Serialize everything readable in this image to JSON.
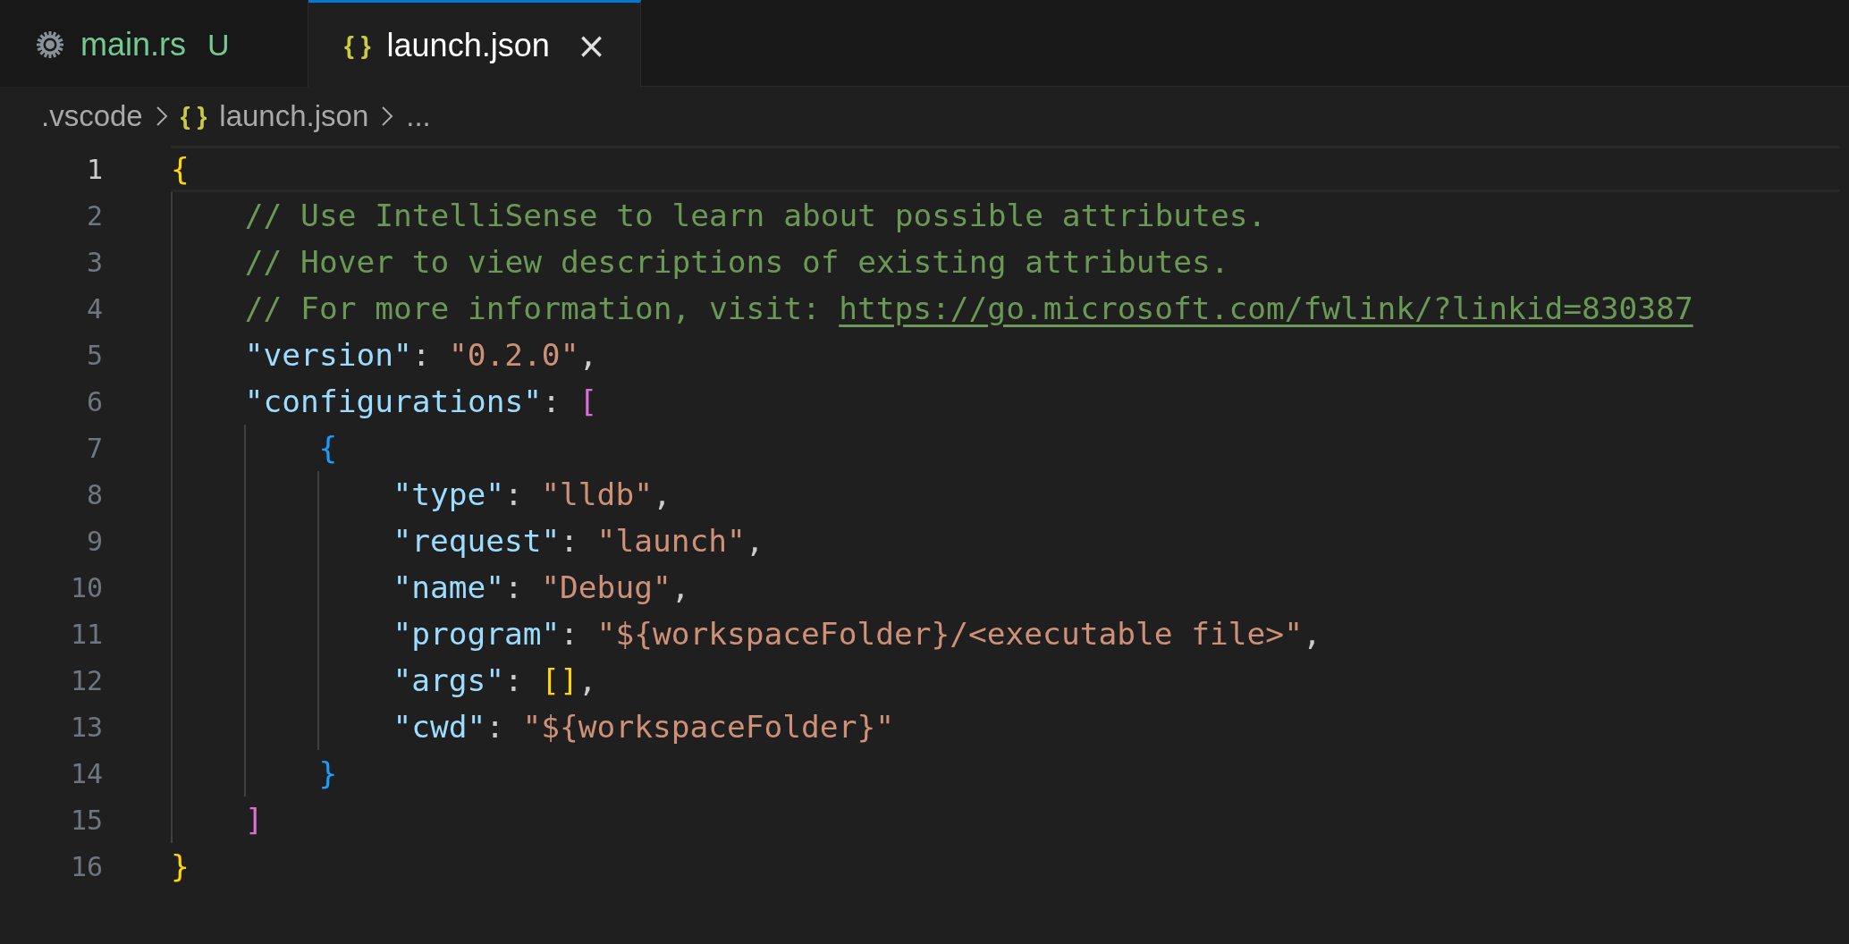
{
  "tabs": [
    {
      "label": "main.rs",
      "icon": {
        "kind": "cog"
      },
      "badge": "U",
      "selected": false
    },
    {
      "label": "launch.json",
      "icon": {
        "kind": "glyph",
        "text": "{ }"
      },
      "close": "×",
      "selected": true
    }
  ],
  "breadcrumbs": [
    {
      "label": ".vscode"
    },
    {
      "label": "launch.json",
      "icon": "{ }"
    },
    {
      "label": "..."
    }
  ],
  "editor": {
    "lines": [
      {
        "number": "1",
        "current": true,
        "tokens": [
          {
            "kind": "bracket",
            "text": "{",
            "color": "#ffd700"
          }
        ],
        "children": [
          {
            "number": "2",
            "current": false,
            "tokens": [
              {
                "kind": "comment",
                "text": "// Use IntelliSense to learn about possible attributes."
              }
            ]
          },
          {
            "number": "3",
            "current": false,
            "tokens": [
              {
                "kind": "comment",
                "text": "// Hover to view descriptions of existing attributes."
              }
            ]
          },
          {
            "number": "4",
            "current": false,
            "tokens": [
              {
                "kind": "comment",
                "text": "// For more information, visit:"
              },
              {
                "kind": "link",
                "text": "https://go.microsoft.com/fwlink/?linkid=830387"
              }
            ]
          },
          {
            "number": "5",
            "current": false,
            "tokens": [
              {
                "kind": "key",
                "text": "\"version\""
              },
              {
                "kind": "punct",
                "text": ":"
              },
              {
                "kind": "string",
                "text": "\"0.2.0\""
              },
              {
                "kind": "punct",
                "text": ","
              }
            ]
          },
          {
            "number": "6",
            "current": false,
            "tokens": [
              {
                "kind": "key",
                "text": "\"configurations\""
              },
              {
                "kind": "punct",
                "text": ":"
              },
              {
                "kind": "bracket",
                "text": "[",
                "color": "#da70d6"
              }
            ],
            "children": [
              {
                "number": "7",
                "current": false,
                "tokens": [
                  {
                    "kind": "bracket",
                    "text": "{",
                    "color": "#179fff"
                  }
                ],
                "children": [
                  {
                    "number": "8",
                    "current": false,
                    "tokens": [
                      {
                        "kind": "key",
                        "text": "\"type\""
                      },
                      {
                        "kind": "punct",
                        "text": ":"
                      },
                      {
                        "kind": "string",
                        "text": "\"lldb\""
                      },
                      {
                        "kind": "punct",
                        "text": ","
                      }
                    ]
                  },
                  {
                    "number": "9",
                    "current": false,
                    "tokens": [
                      {
                        "kind": "key",
                        "text": "\"request\""
                      },
                      {
                        "kind": "punct",
                        "text": ":"
                      },
                      {
                        "kind": "string",
                        "text": "\"launch\""
                      },
                      {
                        "kind": "punct",
                        "text": ","
                      }
                    ]
                  },
                  {
                    "number": "10",
                    "current": false,
                    "tokens": [
                      {
                        "kind": "key",
                        "text": "\"name\""
                      },
                      {
                        "kind": "punct",
                        "text": ":"
                      },
                      {
                        "kind": "string",
                        "text": "\"Debug\""
                      },
                      {
                        "kind": "punct",
                        "text": ","
                      }
                    ]
                  },
                  {
                    "number": "11",
                    "current": false,
                    "tokens": [
                      {
                        "kind": "key",
                        "text": "\"program\""
                      },
                      {
                        "kind": "punct",
                        "text": ":"
                      },
                      {
                        "kind": "string",
                        "text": "\"${workspaceFolder}/<executable file>\""
                      },
                      {
                        "kind": "punct",
                        "text": ","
                      }
                    ]
                  },
                  {
                    "number": "12",
                    "current": false,
                    "tokens": [
                      {
                        "kind": "key",
                        "text": "\"args\""
                      },
                      {
                        "kind": "punct",
                        "text": ":"
                      },
                      {
                        "kind": "bracket",
                        "text": "[]",
                        "color": "#ffd700"
                      },
                      {
                        "kind": "punct",
                        "text": ","
                      }
                    ]
                  },
                  {
                    "number": "13",
                    "current": false,
                    "tokens": [
                      {
                        "kind": "key",
                        "text": "\"cwd\""
                      },
                      {
                        "kind": "punct",
                        "text": ":"
                      },
                      {
                        "kind": "string",
                        "text": "\"${workspaceFolder}\""
                      }
                    ]
                  }
                ]
              },
              {
                "number": "14",
                "current": false,
                "tokens": [
                  {
                    "kind": "bracket",
                    "text": "}",
                    "color": "#179fff"
                  }
                ]
              }
            ]
          },
          {
            "number": "15",
            "current": false,
            "tokens": [
              {
                "kind": "bracket",
                "text": "]",
                "color": "#da70d6"
              }
            ]
          }
        ]
      },
      {
        "number": "16",
        "current": false,
        "tokens": [
          {
            "kind": "bracket",
            "text": "}",
            "color": "#ffd700"
          }
        ]
      }
    ]
  }
}
